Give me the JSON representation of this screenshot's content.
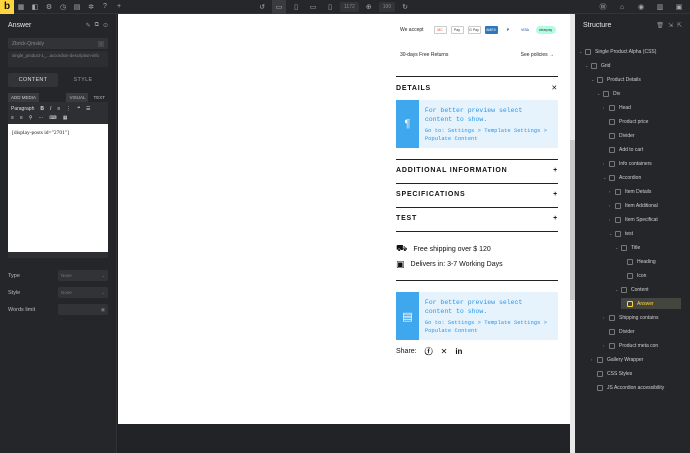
{
  "toolbar": {
    "logo": "b",
    "width_value": "1172",
    "zoom_value": "100"
  },
  "left_panel": {
    "title": "Answer",
    "css_class": "Zbrick-Qmskly",
    "selector": "single_product-1_...accordion-description-info",
    "tabs": [
      "CONTENT",
      "STYLE"
    ],
    "add_media": "ADD MEDIA",
    "visual": "VISUAL",
    "text": "TEXT",
    "paragraph": "Paragraph",
    "editor_content": "[display-posts id=\"2701\"]",
    "props": [
      {
        "label": "Type",
        "value": "None"
      },
      {
        "label": "Style",
        "value": "None"
      },
      {
        "label": "Words limit",
        "value": ""
      }
    ]
  },
  "canvas": {
    "we_accept": "We accept",
    "payments": [
      "MC",
      "Pay",
      "G Pay",
      "AMEX",
      "P",
      "VISA",
      "clearpay"
    ],
    "returns": "30-days Free Returns",
    "see_policies": "See policies",
    "details": "DETAILS",
    "notice_title": "For better preview select content to show.",
    "notice_path": "Go to: Settings > Template Settings > Populate Content",
    "additional_info": "ADDITIONAL INFORMATION",
    "specifications": "SPECIFICATIONS",
    "test": "TEST",
    "shipping": "Free shipping over $ 120",
    "delivers": "Delivers in: 3-7 Working Days",
    "share": "Share:"
  },
  "structure": {
    "title": "Structure",
    "nodes": [
      {
        "label": "Single Product Alpha (CSS)"
      },
      {
        "label": "Grid"
      },
      {
        "label": "Product Details"
      },
      {
        "label": "Div"
      },
      {
        "label": "Head"
      },
      {
        "label": "Product price"
      },
      {
        "label": "Divider"
      },
      {
        "label": "Add to cart"
      },
      {
        "label": "Info containers"
      },
      {
        "label": "Accordion"
      },
      {
        "label": "Item Details"
      },
      {
        "label": "Item Additional"
      },
      {
        "label": "Item Specificat"
      },
      {
        "label": "test"
      },
      {
        "label": "Title"
      },
      {
        "label": "Heading"
      },
      {
        "label": "Icon"
      },
      {
        "label": "Content"
      },
      {
        "label": "Answer"
      },
      {
        "label": "Shipping contains"
      },
      {
        "label": "Divider"
      },
      {
        "label": "Product meta con"
      },
      {
        "label": "Gallery Wrapper"
      },
      {
        "label": "CSS Styles"
      },
      {
        "label": "JS Accordion accessibility"
      }
    ]
  },
  "colors": {
    "accent": "#ffd53e",
    "notice_blue": "#3ea7ee",
    "notice_bg": "#e6f3fd"
  }
}
